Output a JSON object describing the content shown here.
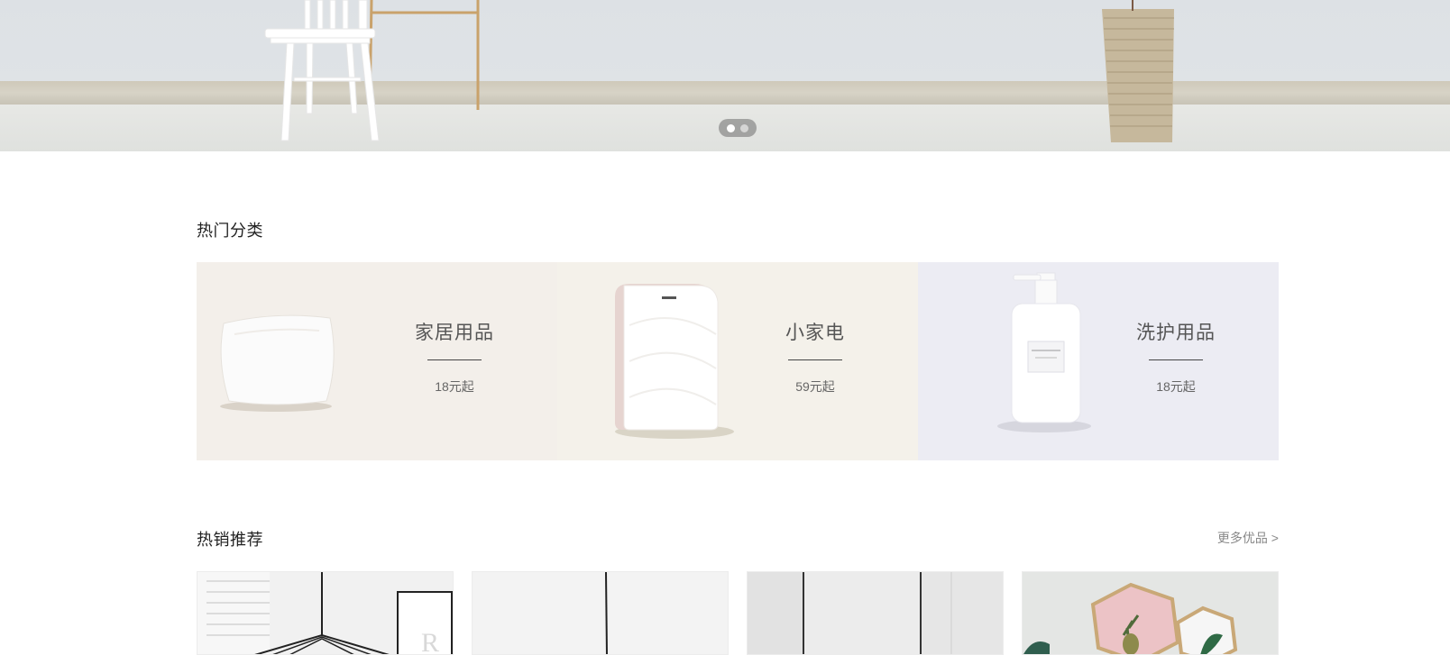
{
  "banner": {
    "slides": 2,
    "active_slide": 1,
    "image": "living-room-banner"
  },
  "hot_categories": {
    "title": "热门分类",
    "items": [
      {
        "name": "家居用品",
        "price": "18元起",
        "icon": "pillow-image",
        "bg": "#f3efea"
      },
      {
        "name": "小家电",
        "price": "59元起",
        "icon": "air-purifier-image",
        "bg": "#f4f1ea"
      },
      {
        "name": "洗护用品",
        "price": "18元起",
        "icon": "pump-bottle-image",
        "bg": "#ececf3"
      }
    ]
  },
  "hot_sales": {
    "title": "热销推荐",
    "more": "更多优品 >",
    "products": [
      {
        "icon": "pendant-lamp-image"
      },
      {
        "icon": "floor-lamp-image"
      },
      {
        "icon": "wardrobe-image"
      },
      {
        "icon": "hexagon-frames-image"
      }
    ]
  },
  "colors": {
    "text_primary": "#222222",
    "text_muted": "#888888",
    "card_home": "#f3efea",
    "card_appliance": "#f4f1ea",
    "card_care": "#ececf3"
  }
}
